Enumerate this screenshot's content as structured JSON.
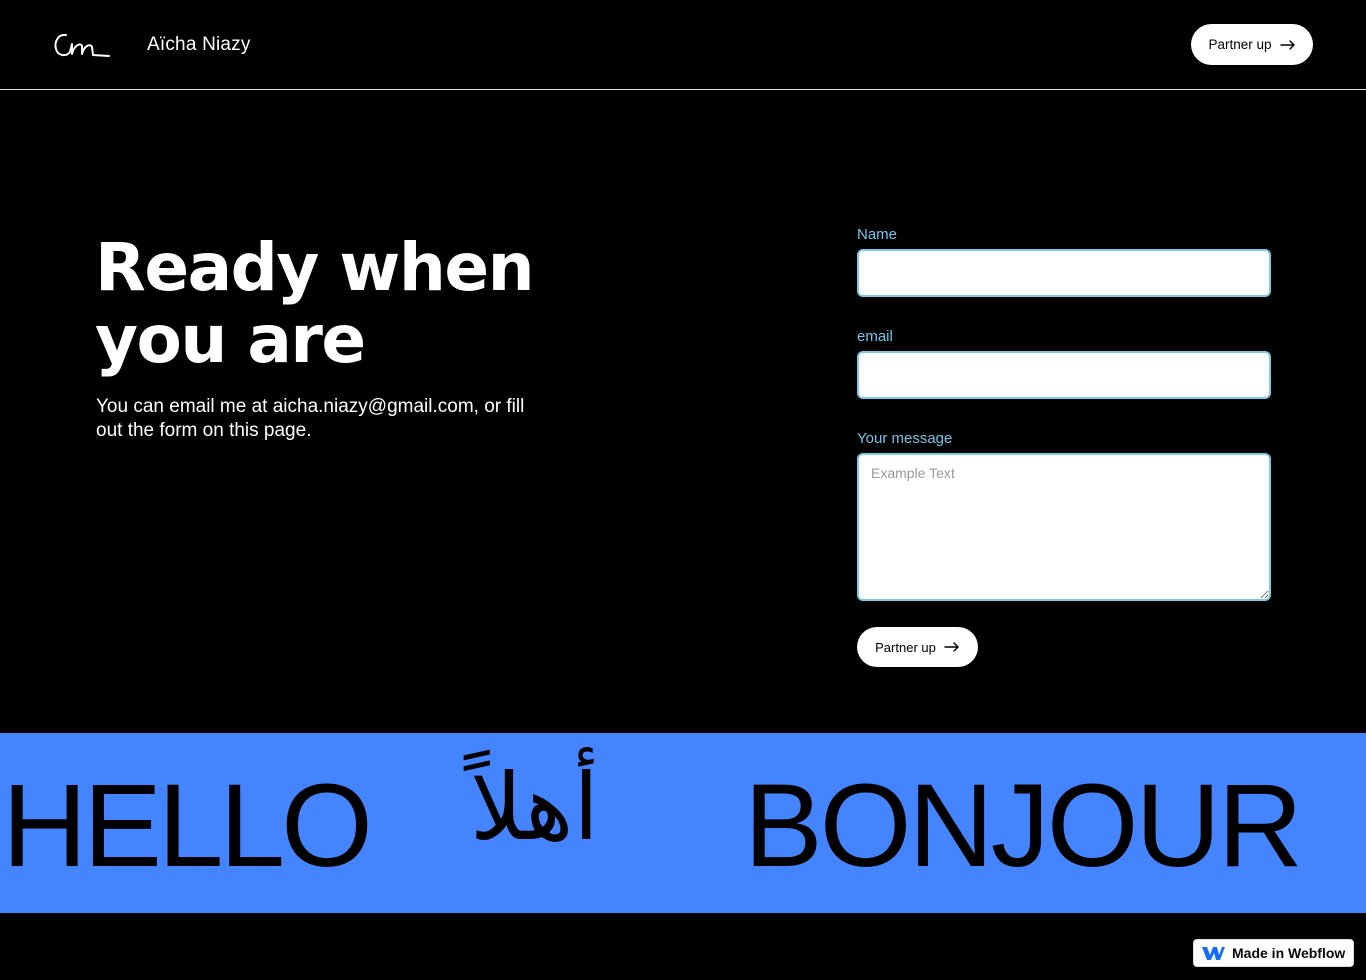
{
  "header": {
    "logo_alt": "Aïcha Niazy logo",
    "site_name": "Aïcha Niazy",
    "cta_label": "Partner up"
  },
  "hero": {
    "title_line1": "Ready when",
    "title_line2": "you are",
    "text": "You can email me at aicha.niazy@gmail.com, or fill out the form on this page."
  },
  "form": {
    "name_label": "Name",
    "name_value": "",
    "email_label": "email",
    "email_value": "",
    "message_label": "Your message",
    "message_placeholder": "Example Text",
    "submit_label": "Partner up"
  },
  "banner": {
    "words": [
      "HELLO",
      "أهلاً",
      "BONJOUR"
    ],
    "background": "#4584ff"
  },
  "badge": {
    "label": "Made in Webflow",
    "icon": "webflow-icon"
  },
  "colors": {
    "background": "#000000",
    "accent_label": "#6fc6e8",
    "input_border": "#7ccbe4",
    "banner": "#4584ff"
  }
}
